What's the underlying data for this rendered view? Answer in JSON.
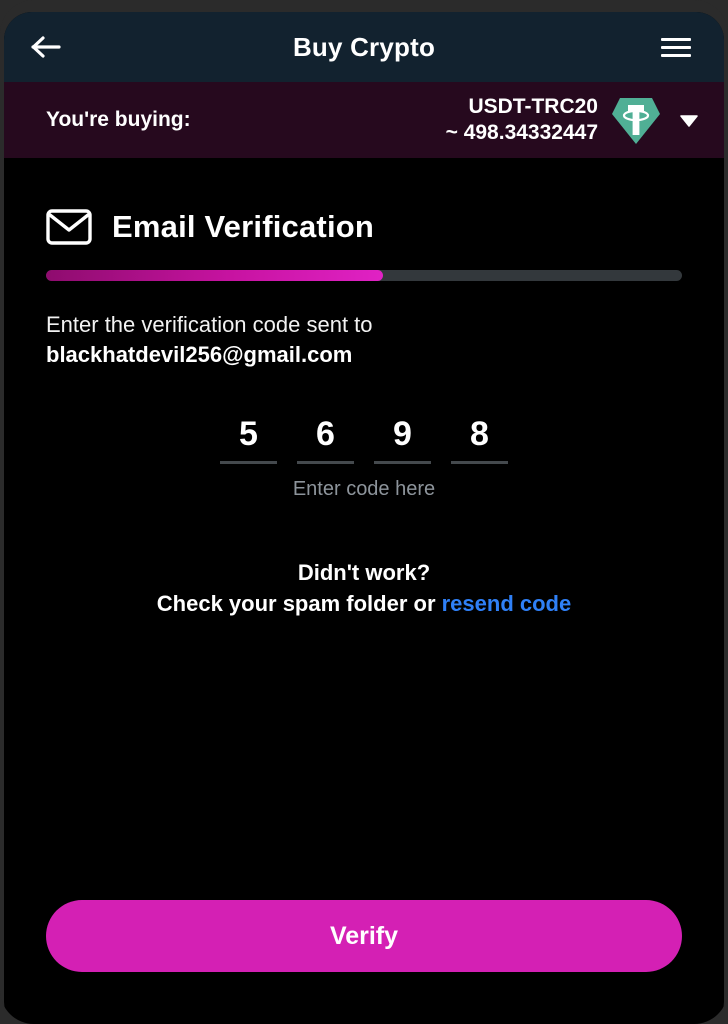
{
  "topbar": {
    "back_icon": "arrow-left-icon",
    "title": "Buy Crypto",
    "menu_icon": "hamburger-menu-icon"
  },
  "buying_bar": {
    "label": "You're buying:",
    "asset_symbol": "USDT-TRC20",
    "asset_amount": "~ 498.34332447",
    "asset_logo_icon": "tether-usdt-icon",
    "chevron_icon": "chevron-down-icon",
    "background_color": "#26091e"
  },
  "verification": {
    "mail_icon": "envelope-icon",
    "title": "Email Verification",
    "progress_percent": 53,
    "progress_color": "#c713a1",
    "instruction": "Enter the verification code sent to",
    "email": "blackhatdevil256@gmail.com",
    "code_digits": [
      "5",
      "6",
      "9",
      "8"
    ],
    "code_placeholder": "Enter code here"
  },
  "resend": {
    "title": "Didn't work?",
    "prefix": "Check your spam folder or ",
    "link": "resend code",
    "link_color": "#2f80f7"
  },
  "footer": {
    "verify_label": "Verify",
    "verify_color": "#d420b4"
  },
  "theme": {
    "header_color": "#12222f",
    "background_color": "#000000",
    "frame_color": "#2b2b2b"
  }
}
